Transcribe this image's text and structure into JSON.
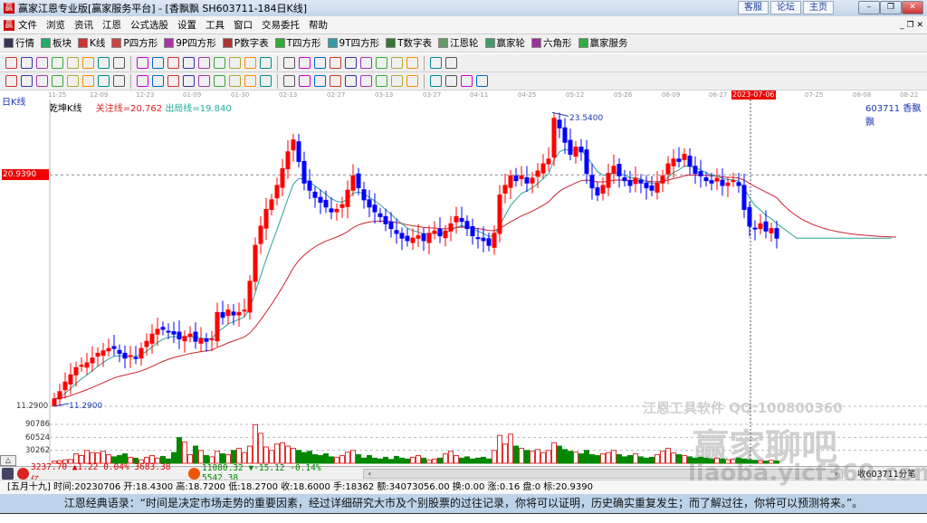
{
  "window": {
    "title": "赢家江恩专业版[赢家服务平台] - [香飘飘  SH603711-184日K线]",
    "links": [
      "客服",
      "论坛",
      "主页"
    ],
    "logo": "赢"
  },
  "menu": [
    "文件",
    "浏览",
    "资讯",
    "江恩",
    "公式选股",
    "设置",
    "工具",
    "窗口",
    "交易委托",
    "帮助"
  ],
  "toolbar1": [
    {
      "label": "行情",
      "icon": "quotes-icon",
      "color": "#335"
    },
    {
      "label": "板块",
      "icon": "sector-icon",
      "color": "#2a6"
    },
    {
      "label": "K线",
      "icon": "kline-icon",
      "color": "#c33"
    },
    {
      "label": "P四方形",
      "icon": "p-square-icon",
      "color": "#c44"
    },
    {
      "label": "9P四方形",
      "icon": "9p-square-icon",
      "color": "#a3a"
    },
    {
      "label": "P数字表",
      "icon": "p-table-icon",
      "color": "#a33"
    },
    {
      "label": "T四方形",
      "icon": "t-square-icon",
      "color": "#3a3"
    },
    {
      "label": "9T四方形",
      "icon": "9t-square-icon",
      "color": "#39a"
    },
    {
      "label": "T数字表",
      "icon": "t-table-icon",
      "color": "#373"
    },
    {
      "label": "江恩轮",
      "icon": "gann-wheel-icon",
      "color": "#696"
    },
    {
      "label": "赢家轮",
      "icon": "winner-wheel-icon",
      "color": "#496"
    },
    {
      "label": "六角形",
      "icon": "hexagon-icon",
      "color": "#939"
    },
    {
      "label": "赢家服务",
      "icon": "dollar-icon",
      "color": "#3a4"
    }
  ],
  "toolbar2": [
    "period-icon",
    "link-icon",
    "doc-icon",
    "chart-up-icon",
    "chart-down-icon",
    "cursor-icon",
    "refresh-icon",
    "flag-icon",
    "first-icon",
    "last-icon",
    "left-icon",
    "right-icon",
    "zoom-in-icon",
    "zoom-out-icon",
    "expand-icon",
    "shrink-icon",
    "up-icon",
    "down-icon",
    "hand-icon",
    "crosshair-icon",
    "line-icon",
    "formula-icon",
    "stats-icon",
    "calendar-icon",
    "calc-icon",
    "report-icon",
    "save-icon",
    "network-icon"
  ],
  "toolbar3": [
    "pen-icon",
    "grid-icon",
    "gann-fan-icon",
    "gann-fan2-icon",
    "fibo-icon",
    "arc-icon",
    "angle-icon",
    "circle-icon",
    "parallel-icon",
    "ratio-icon",
    "triangle-icon",
    "target-icon",
    "star-icon",
    "box-icon",
    "wave-icon",
    "time-icon",
    "time2-icon",
    "cycle-icon",
    "cycle2-icon",
    "rect-icon",
    "fan-icon",
    "grid2-icon",
    "grid3-icon",
    "ray-icon",
    "zigzag-icon",
    "mesh-icon",
    "mesh2-icon",
    "lines-icon",
    "color-icon",
    "infinity-icon"
  ],
  "dates": [
    "11-25",
    "12-09",
    "12-23",
    "01-09",
    "01-30",
    "02-13",
    "02-27",
    "03-13",
    "03-27",
    "04-11",
    "04-25",
    "05-12",
    "05-26",
    "06-09",
    "06-27",
    "2023-07-06",
    "07-25",
    "08-08",
    "08-22"
  ],
  "chart_labels": {
    "period": "日K线",
    "indicator": "乾坤K线",
    "focus_line": "关注线=20.762",
    "exit_line": "出局线=19.840",
    "stock": "603711  香飘飘",
    "price_marker": "20.9390",
    "high_label": "23.5400",
    "low_label": "11.2900",
    "low_axis": "11.2900",
    "vol_ticks": [
      "90786",
      "60524",
      "30262"
    ]
  },
  "chart_data": {
    "type": "candlestick",
    "high": 23.54,
    "low": 11.29,
    "marker_price": 20.939,
    "vol_ticks": [
      30262,
      60524,
      90786
    ],
    "close": [
      11.6,
      11.9,
      12.3,
      12.6,
      12.9,
      13.0,
      13.1,
      13.3,
      13.5,
      13.6,
      13.7,
      13.7,
      13.5,
      13.3,
      13.4,
      13.3,
      13.7,
      14.0,
      14.3,
      14.5,
      14.5,
      14.4,
      14.3,
      14.1,
      14.2,
      14.3,
      14.0,
      14.1,
      14.0,
      14.1,
      15.2,
      15.0,
      15.3,
      15.1,
      15.2,
      15.3,
      16.5,
      18.0,
      18.8,
      19.5,
      19.9,
      20.5,
      21.2,
      21.9,
      22.4,
      21.5,
      20.6,
      20.3,
      20.0,
      19.8,
      19.6,
      19.4,
      19.5,
      19.7,
      20.3,
      20.9,
      20.4,
      19.9,
      19.6,
      19.4,
      19.2,
      18.9,
      18.7,
      18.5,
      18.3,
      18.2,
      18.3,
      18.4,
      18.2,
      18.5,
      18.6,
      18.4,
      18.6,
      18.9,
      19.2,
      19.0,
      18.7,
      18.4,
      18.3,
      18.2,
      18.0,
      18.5,
      20.1,
      20.5,
      20.9,
      20.7,
      20.9,
      20.6,
      20.8,
      21.1,
      21.4,
      21.6,
      23.3,
      22.9,
      22.3,
      21.8,
      22.1,
      21.9,
      21.0,
      20.4,
      20.1,
      20.5,
      21.0,
      21.3,
      20.9,
      20.7,
      20.5,
      20.8,
      20.6,
      20.4,
      20.3,
      20.6,
      20.9,
      21.4,
      21.6,
      21.5,
      21.8,
      21.3,
      21.0,
      20.9,
      20.7,
      20.6,
      20.8,
      20.5,
      20.6,
      20.7,
      20.5,
      19.5,
      18.8,
      18.7,
      18.9,
      18.6,
      18.7,
      18.3
    ],
    "volume": [
      5000,
      6000,
      8000,
      9000,
      22000,
      18000,
      30000,
      25000,
      24000,
      28000,
      20000,
      15000,
      18000,
      22000,
      14000,
      12000,
      8000,
      14000,
      18000,
      12000,
      16000,
      10000,
      25000,
      60000,
      50000,
      20000,
      40000,
      30000,
      18000,
      15000,
      28000,
      22000,
      20000,
      30000,
      35000,
      25000,
      40000,
      90000,
      70000,
      38000,
      30000,
      45000,
      48000,
      40000,
      35000,
      30000,
      25000,
      28000,
      20000,
      18000,
      22000,
      15000,
      14000,
      18000,
      26000,
      30000,
      20000,
      12000,
      18000,
      12000,
      10000,
      14000,
      9000,
      16000,
      12000,
      10000,
      14000,
      18000,
      12000,
      8000,
      10000,
      12000,
      22000,
      28000,
      18000,
      12000,
      15000,
      10000,
      12000,
      14000,
      10000,
      30000,
      65000,
      45000,
      68000,
      40000,
      35000,
      30000,
      28000,
      32000,
      25000,
      30000,
      48000,
      40000,
      32000,
      28000,
      26000,
      22000,
      30000,
      20000,
      18000,
      22000,
      25000,
      30000,
      20000,
      15000,
      18000,
      22000,
      15000,
      12000,
      14000,
      20000,
      28000,
      35000,
      24000,
      20000,
      18000,
      15000,
      12000,
      14000,
      12000,
      10000,
      12000,
      10000,
      8000,
      9000,
      12000,
      10000,
      8000,
      7000,
      6000,
      5000,
      7000,
      5000
    ],
    "up_color": "#ff0000",
    "down_color": "#0000ff",
    "vol_down_color": "#008800",
    "ma_short_color": "#2aa198",
    "ma_long_color": "#cc2233"
  },
  "index_bar": {
    "sh": "3237.70 ▲1.22 0.04% 3683.38亿",
    "sz": "11080.32 ▼-15.12 -0.14% 5542.38",
    "right": "收603711分笔"
  },
  "status": "[五月十九] 时间:20230706 开:18.4300 高:18.7200 低:18.2700 收:18.6000 手:18362 额:34073056.00 换:0.00 涨:0.16 盘:0 标:20.9390",
  "quote": "江恩经典语录：“时间是决定市场走势的重要因素，经过详细研究大市及个别股票的过往记录，你将可以证明，历史确实重复发生；而了解过往，你将可以预测将来。”。",
  "watermark": {
    "line1": "江恩工具软件  QQ:100800360",
    "line2": "赢家聊吧",
    "line3": "liaoba.yicf360.com"
  }
}
